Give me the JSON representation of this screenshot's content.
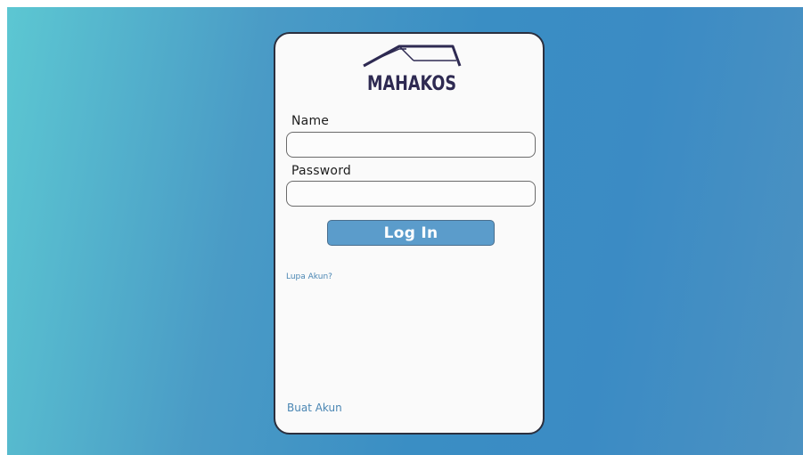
{
  "brand": {
    "name": "MAHAKOS",
    "accent_color": "#5b9ccb",
    "logo_color": "#2e2a52"
  },
  "form": {
    "name_label": "Name",
    "name_value": "",
    "password_label": "Password",
    "password_value": "",
    "login_label": "Log In"
  },
  "links": {
    "forgot": "Lupa Akun?",
    "create": "Buat Akun"
  }
}
